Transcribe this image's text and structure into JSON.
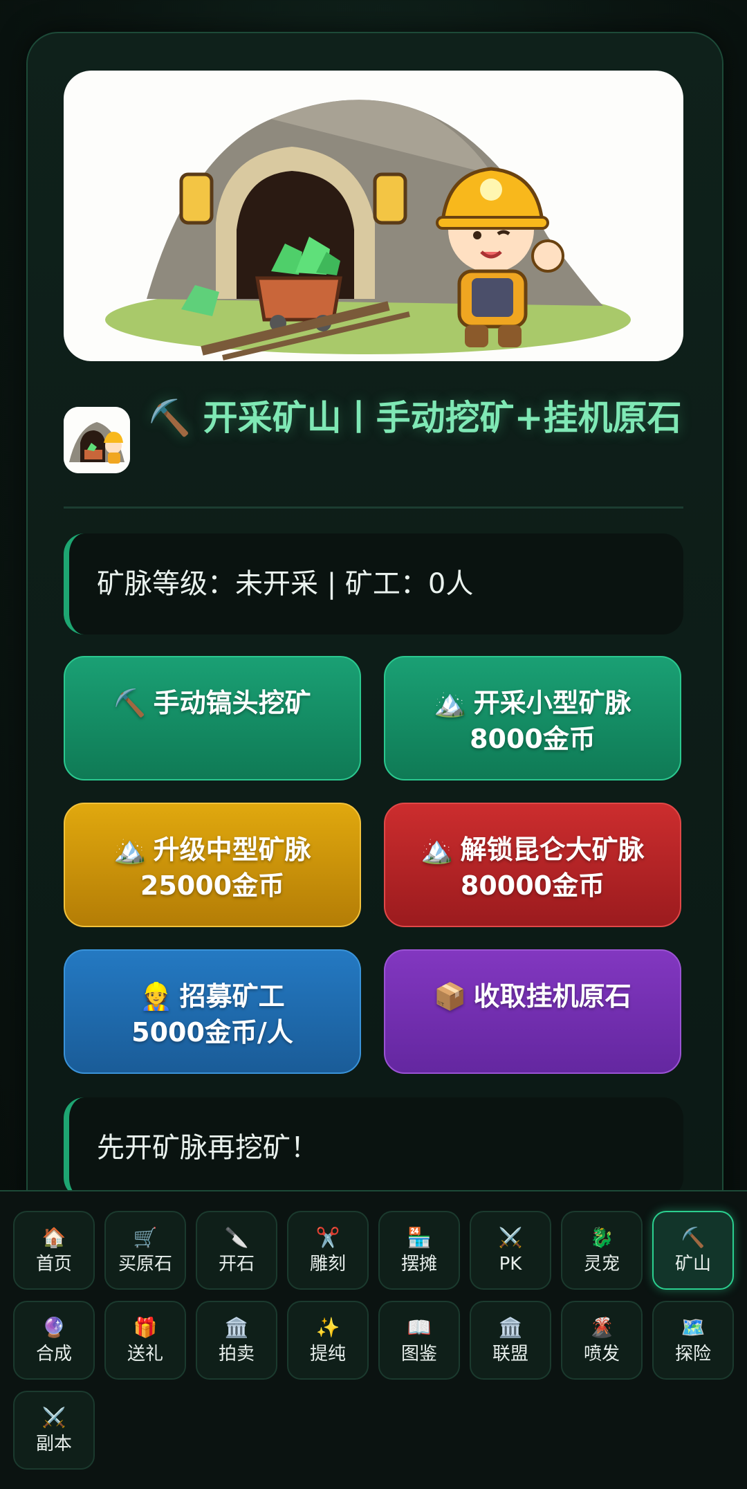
{
  "title": "⛏️ 开采矿山丨手动挖矿+挂机原石",
  "status": "矿脉等级：未开采 | 矿工：0人",
  "buttons": [
    {
      "icon": "⛏️",
      "label": "手动镐头挖矿",
      "sub": ""
    },
    {
      "icon": "🏔️",
      "label": "开采小型矿脉",
      "sub": "8000金币"
    },
    {
      "icon": "🏔️",
      "label": "升级中型矿脉",
      "sub": "25000金币"
    },
    {
      "icon": "🏔️",
      "label": "解锁昆仑大矿脉",
      "sub": "80000金币"
    },
    {
      "icon": "👷",
      "label": "招募矿工",
      "sub": "5000金币/人"
    },
    {
      "icon": "📦",
      "label": "收取挂机原石",
      "sub": ""
    }
  ],
  "message": "先开矿脉再挖矿！",
  "nav": [
    {
      "icon": "🏠",
      "label": "首页"
    },
    {
      "icon": "🛒",
      "label": "买原石"
    },
    {
      "icon": "🔪",
      "label": "开石"
    },
    {
      "icon": "✂️",
      "label": "雕刻"
    },
    {
      "icon": "🏪",
      "label": "摆摊"
    },
    {
      "icon": "⚔️",
      "label": "PK"
    },
    {
      "icon": "🐉",
      "label": "灵宠"
    },
    {
      "icon": "⛏️",
      "label": "矿山"
    },
    {
      "icon": "🔮",
      "label": "合成"
    },
    {
      "icon": "🎁",
      "label": "送礼"
    },
    {
      "icon": "🏛️",
      "label": "拍卖"
    },
    {
      "icon": "✨",
      "label": "提纯"
    },
    {
      "icon": "📖",
      "label": "图鉴"
    },
    {
      "icon": "🏛️",
      "label": "联盟"
    },
    {
      "icon": "🌋",
      "label": "喷发"
    },
    {
      "icon": "🗺️",
      "label": "探险"
    },
    {
      "icon": "⚔️",
      "label": "副本"
    }
  ],
  "active_nav": "矿山",
  "colors": {
    "accent": "#2bcf8f",
    "title": "#7fe8b5",
    "green_btn": "#1aa074",
    "gold_btn": "#e0a80e",
    "red_btn": "#cc2d2e",
    "blue_btn": "#2479c2",
    "purple_btn": "#8237c0"
  }
}
